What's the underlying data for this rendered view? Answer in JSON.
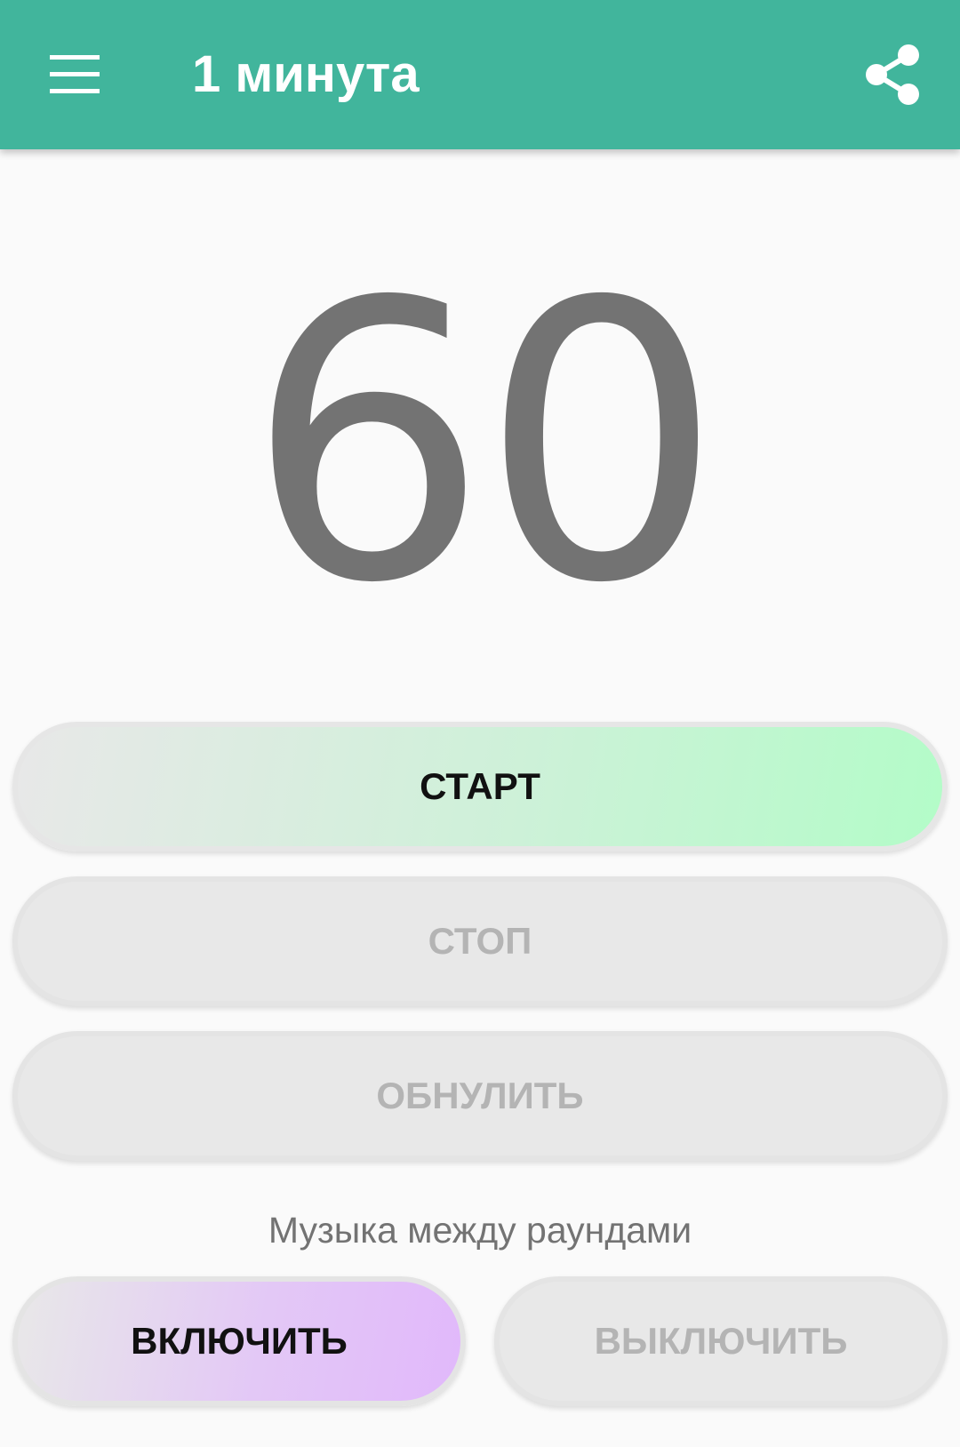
{
  "app_bar": {
    "title": "1 минута",
    "menu_icon": "hamburger-menu-icon",
    "share_icon": "share-icon",
    "background_color": "#41b59c"
  },
  "timer": {
    "value": "60"
  },
  "controls": {
    "start_label": "СТАРТ",
    "stop_label": "СТОП",
    "reset_label": "ОБНУЛИТЬ"
  },
  "music": {
    "label": "Музыка между раундами",
    "on_label": "ВКЛЮЧИТЬ",
    "off_label": "ВЫКЛЮЧИТЬ"
  },
  "colors": {
    "start_gradient_end": "#b3fcc8",
    "on_gradient_end": "#e1b8fb",
    "disabled_text": "#b4b4b4",
    "timer_text": "#737373"
  }
}
